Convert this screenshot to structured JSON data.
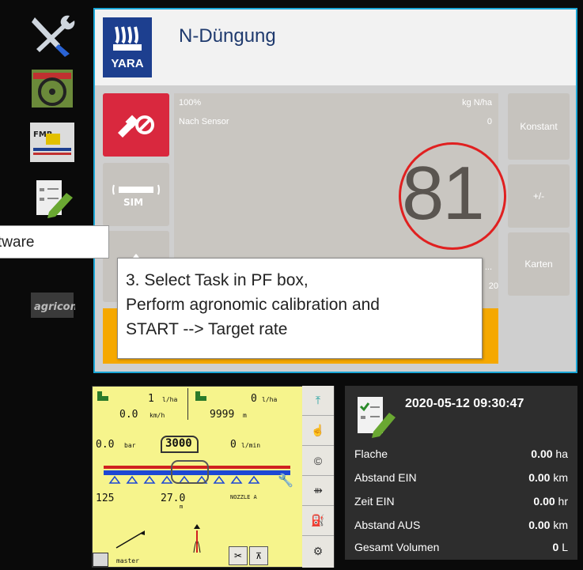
{
  "app": {
    "title": "N-Düngung",
    "logo_text": "YARA"
  },
  "panel": {
    "percent": "100%",
    "unit": "kg N/ha",
    "source_label": "Nach Sensor",
    "source_value": "0",
    "rate_value": "81",
    "bottom_left_partial": "...",
    "bottom_right_partial": "20"
  },
  "right_buttons": {
    "konstant": "Konstant",
    "plusminus": "+/-",
    "karten": "Karten"
  },
  "callouts": {
    "left": "tware",
    "main_line1": "3. Select Task in PF box,",
    "main_line2": "Perform agronomic calibration and",
    "main_line3": "START -->  Target rate"
  },
  "sprayer": {
    "rate1": "1",
    "rate1_unit": "l/ha",
    "rate2": "0",
    "rate2_unit": "l/ha",
    "speed": "0.0",
    "speed_unit": "km/h",
    "distance": "9999",
    "distance_unit": "m",
    "pressure": "0.0",
    "pressure_unit": "bar",
    "tank": "3000",
    "flow": "0",
    "flow_unit": "l/min",
    "width": "125",
    "boom": "27.0",
    "boom_unit": "m",
    "nozzle": "NOZZLE A",
    "status": "master"
  },
  "task": {
    "datetime": "2020-05-12 09:30:47",
    "rows": [
      {
        "label": "Flache",
        "value": "0.00",
        "unit": "ha"
      },
      {
        "label": "Abstand EIN",
        "value": "0.00",
        "unit": "km"
      },
      {
        "label": "Zeit EIN",
        "value": "0.00",
        "unit": "hr"
      },
      {
        "label": "Abstand AUS",
        "value": "0.00",
        "unit": "km"
      },
      {
        "label": "Gesamt Volumen",
        "value": "0",
        "unit": "L"
      }
    ]
  },
  "colors": {
    "frame": "#1aa6d6",
    "accent_red": "#d9283e",
    "accent_orange": "#f5a800",
    "yara_blue": "#1d3f8f"
  },
  "icons": [
    "tools-icon",
    "steering-wheel-icon",
    "fmr-sprayer-icon",
    "checklist-pencil-icon",
    "agricon-logo-icon",
    "satellite-off-icon",
    "sim-icon",
    "plant-icon"
  ]
}
